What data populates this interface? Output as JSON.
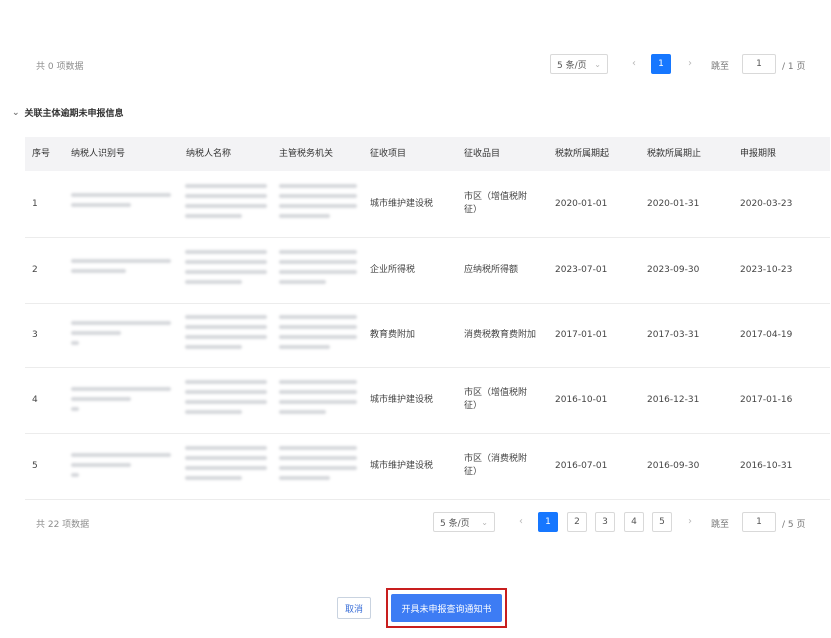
{
  "top_pager": {
    "total": "共 0 项数据",
    "page_size": "5 条/页",
    "pages": [
      "1"
    ],
    "active_page": "1",
    "jump_label": "跳至",
    "jump_value": "1",
    "page_total": "/ 1 页"
  },
  "section": {
    "title": "关联主体逾期未申报信息"
  },
  "table": {
    "headers": [
      "序号",
      "纳税人识别号",
      "纳税人名称",
      "主管税务机关",
      "征收项目",
      "征收品目",
      "税款所属期起",
      "税款所属期止",
      "申报期限"
    ],
    "rows": [
      {
        "no": "1",
        "item": "城市维护建设税",
        "sub": [
          "市区（增值税附",
          "征）"
        ],
        "start": "2020-01-01",
        "end": "2020-01-31",
        "deadline": "2020-03-23"
      },
      {
        "no": "2",
        "item": "企业所得税",
        "sub": [
          "应纳税所得额"
        ],
        "start": "2023-07-01",
        "end": "2023-09-30",
        "deadline": "2023-10-23"
      },
      {
        "no": "3",
        "item": "教育费附加",
        "sub": [
          "消费税教育费附加"
        ],
        "start": "2017-01-01",
        "end": "2017-03-31",
        "deadline": "2017-04-19"
      },
      {
        "no": "4",
        "item": "城市维护建设税",
        "sub": [
          "市区（增值税附",
          "征）"
        ],
        "start": "2016-10-01",
        "end": "2016-12-31",
        "deadline": "2017-01-16"
      },
      {
        "no": "5",
        "item": "城市维护建设税",
        "sub": [
          "市区（消费税附",
          "征）"
        ],
        "start": "2016-07-01",
        "end": "2016-09-30",
        "deadline": "2016-10-31"
      }
    ]
  },
  "bottom_pager": {
    "total": "共 22 项数据",
    "page_size": "5 条/页",
    "pages": [
      "1",
      "2",
      "3",
      "4",
      "5"
    ],
    "active_page": "1",
    "jump_label": "跳至",
    "jump_value": "1",
    "page_total": "/ 5 页"
  },
  "actions": {
    "cancel_label": "取消",
    "primary_label": "开具未申报查询通知书"
  },
  "colors": {
    "primary": "#1677ff",
    "highlight_border": "#c81e1e",
    "header_bg": "#f3f3f5"
  },
  "icons": {
    "section_toggle": "chevron-down-icon",
    "prev": "chevron-left-icon",
    "next": "chevron-right-icon"
  }
}
